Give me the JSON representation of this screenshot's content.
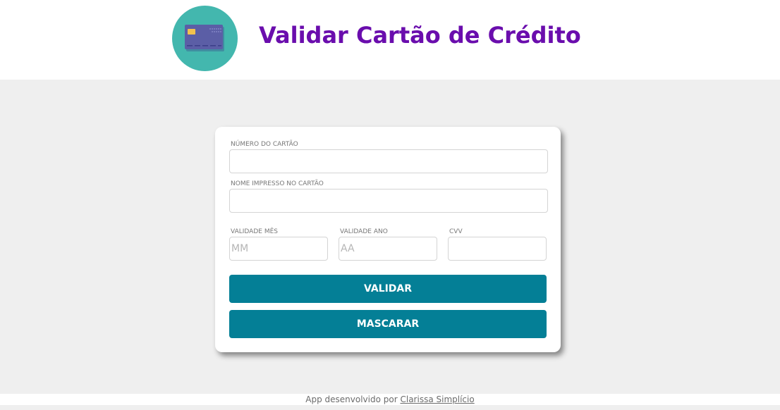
{
  "header": {
    "title": "Validar Cartão de Crédito",
    "logo_icon": "credit-card-icon"
  },
  "form": {
    "card_number": {
      "label": "NÚMERO DO CARTÃO",
      "value": "",
      "placeholder": ""
    },
    "card_name": {
      "label": "NOME IMPRESSO NO CARTÃO",
      "value": "",
      "placeholder": ""
    },
    "exp_month": {
      "label": "VALIDADE MÊS",
      "value": "",
      "placeholder": "MM"
    },
    "exp_year": {
      "label": "VALIDADE ANO",
      "value": "",
      "placeholder": "AA"
    },
    "cvv": {
      "label": "CVV",
      "value": "",
      "placeholder": ""
    },
    "validate_label": "VALIDAR",
    "mask_label": "MASCARAR"
  },
  "footer": {
    "text": "App desenvolvido por ",
    "author_link": "Clarissa Simplício"
  },
  "colors": {
    "title": "#6a0dad",
    "logo_bg": "#43b7ae",
    "button": "#047f96",
    "page_bg": "#efefef"
  }
}
